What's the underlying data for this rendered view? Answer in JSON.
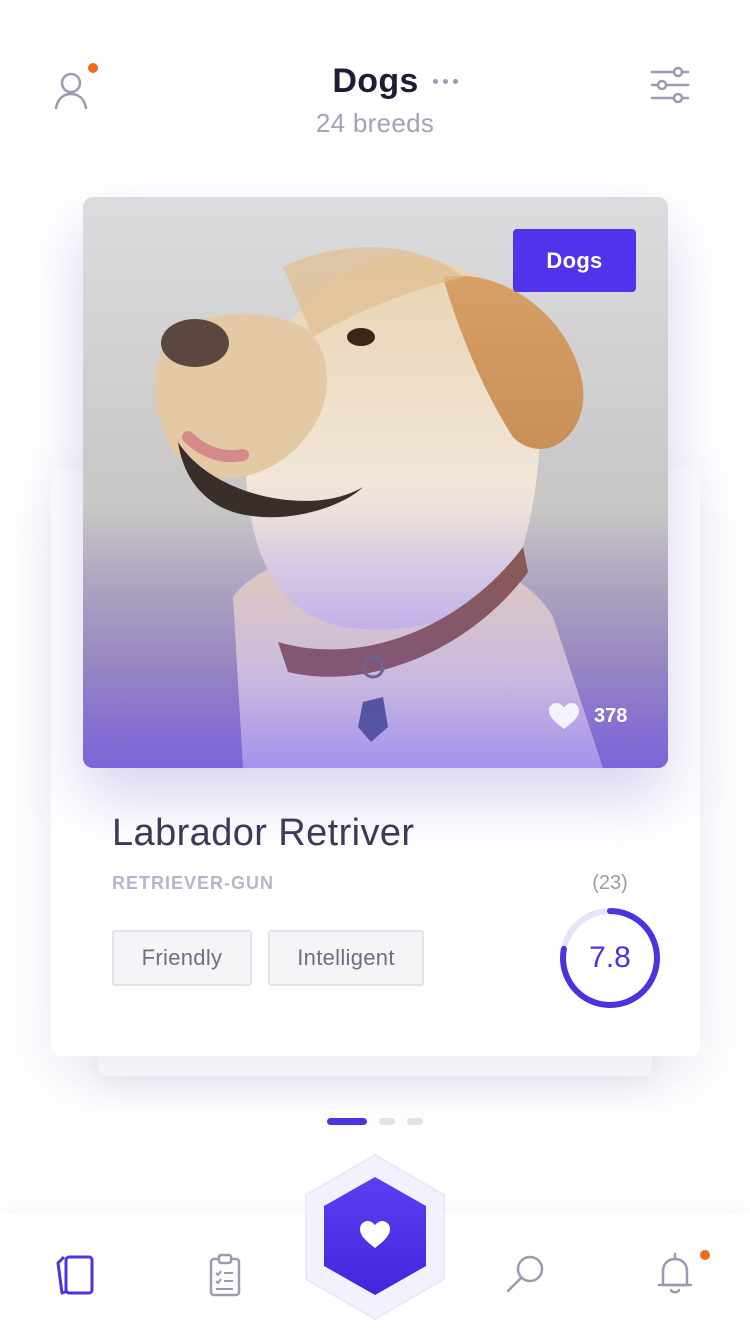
{
  "header": {
    "title": "Dogs",
    "subtitle": "24 breeds",
    "profile_icon": "user-icon",
    "menu_icon": "more-dots-icon",
    "filter_icon": "sliders-icon",
    "notification_color": "#f26a1b"
  },
  "card": {
    "badge": "Dogs",
    "likes": "378",
    "name": "Labrador Retriver",
    "group": "RETRIEVER-GUN",
    "tags": [
      "Friendly",
      "Intelligent"
    ],
    "votes": "(23)",
    "rating": "7.8",
    "rating_fraction": 0.78
  },
  "pager": {
    "count": 3,
    "active_index": 0
  },
  "tabbar": {
    "items": [
      "cards-icon",
      "checklist-icon",
      "heart-icon",
      "search-icon",
      "bell-icon"
    ],
    "active": "cards-icon"
  },
  "colors": {
    "accent": "#4a33e0",
    "badge": "#5034ec",
    "dot": "#f26a1b"
  }
}
